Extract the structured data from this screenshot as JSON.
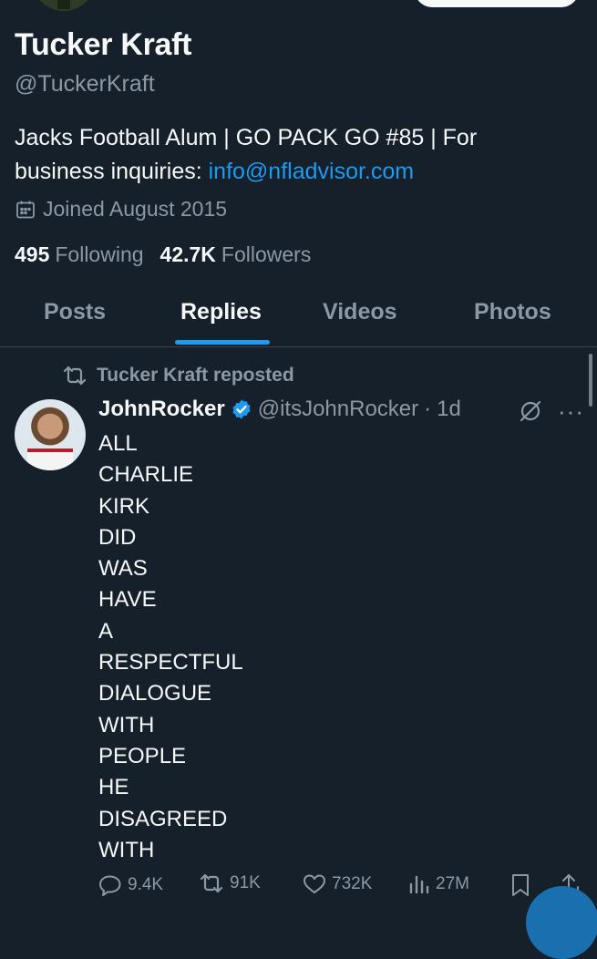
{
  "profile": {
    "name": "Tucker Kraft",
    "handle": "@TuckerKraft",
    "bio_line1": "Jacks Football Alum | GO PACK GO #85 | For",
    "bio_line2_prefix": "business inquiries: ",
    "bio_link": "info@nfladvisor.com",
    "joined": "Joined August 2015",
    "following_count": "495",
    "following_label": "Following",
    "followers_count": "42.7K",
    "followers_label": "Followers"
  },
  "tabs": [
    {
      "label": "Posts"
    },
    {
      "label": "Replies"
    },
    {
      "label": "Videos"
    },
    {
      "label": "Photos"
    }
  ],
  "active_tab": "Replies",
  "post": {
    "repost_label": "Tucker Kraft reposted",
    "author_name": "JohnRocker",
    "author_handle": "@itsJohnRocker",
    "separator": "·",
    "time": "1d",
    "verified": true,
    "lines": [
      "ALL",
      "CHARLIE",
      "KIRK",
      "DID",
      "WAS",
      "HAVE",
      "A",
      "RESPECTFUL",
      "DIALOGUE",
      "WITH",
      "PEOPLE",
      "HE",
      "DISAGREED",
      "WITH"
    ],
    "replies": "9.4K",
    "reposts": "91K",
    "likes": "732K",
    "views": "27M"
  },
  "colors": {
    "background": "#15202b",
    "accent": "#1d9bf0",
    "muted": "#8b98a5",
    "text": "#f7f9f9"
  }
}
